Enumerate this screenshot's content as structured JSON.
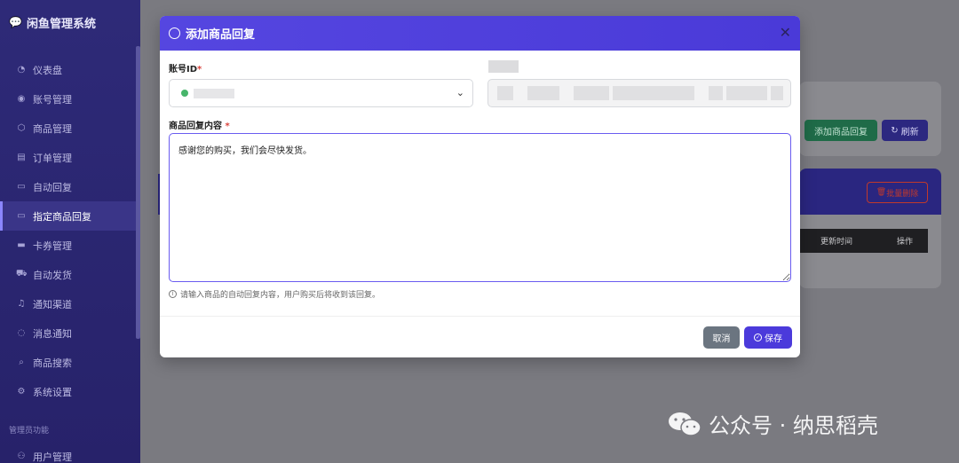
{
  "sidebar": {
    "brand": "闲鱼管理系统",
    "items": [
      {
        "label": "仪表盘",
        "icon": "dashboard-icon"
      },
      {
        "label": "账号管理",
        "icon": "user-icon"
      },
      {
        "label": "商品管理",
        "icon": "box-icon"
      },
      {
        "label": "订单管理",
        "icon": "list-icon"
      },
      {
        "label": "自动回复",
        "icon": "chat-icon"
      },
      {
        "label": "指定商品回复",
        "icon": "chat-icon"
      },
      {
        "label": "卡券管理",
        "icon": "card-icon"
      },
      {
        "label": "自动发货",
        "icon": "truck-icon"
      },
      {
        "label": "通知渠道",
        "icon": "bell-icon"
      },
      {
        "label": "消息通知",
        "icon": "message-icon"
      },
      {
        "label": "商品搜索",
        "icon": "search-icon"
      },
      {
        "label": "系统设置",
        "icon": "gear-icon"
      }
    ],
    "active_index": 5,
    "admin_section": "管理员功能",
    "admin_items": [
      {
        "label": "用户管理",
        "icon": "users-icon"
      }
    ]
  },
  "background": {
    "add_button": "添加商品回复",
    "refresh_button": "刷新",
    "bulk_delete_button": "批量删除",
    "table_headers": [
      "更新时间",
      "操作"
    ]
  },
  "modal": {
    "title": "添加商品回复",
    "account_label": "账号ID",
    "content_label": "商品回复内容",
    "content_value": "感谢您的购买，我们会尽快发货。",
    "hint": "请输入商品的自动回复内容，用户购买后将收到该回复。",
    "cancel_button": "取消",
    "save_button": "保存"
  },
  "watermark": "公众号 · 纳思稻壳",
  "colors": {
    "modal_header": "#4a3ad8",
    "sidebar_bg": "#2e2a78",
    "save_button": "#4b3adb",
    "cancel_button": "#6b7580",
    "required_mark": "#d9423b"
  }
}
